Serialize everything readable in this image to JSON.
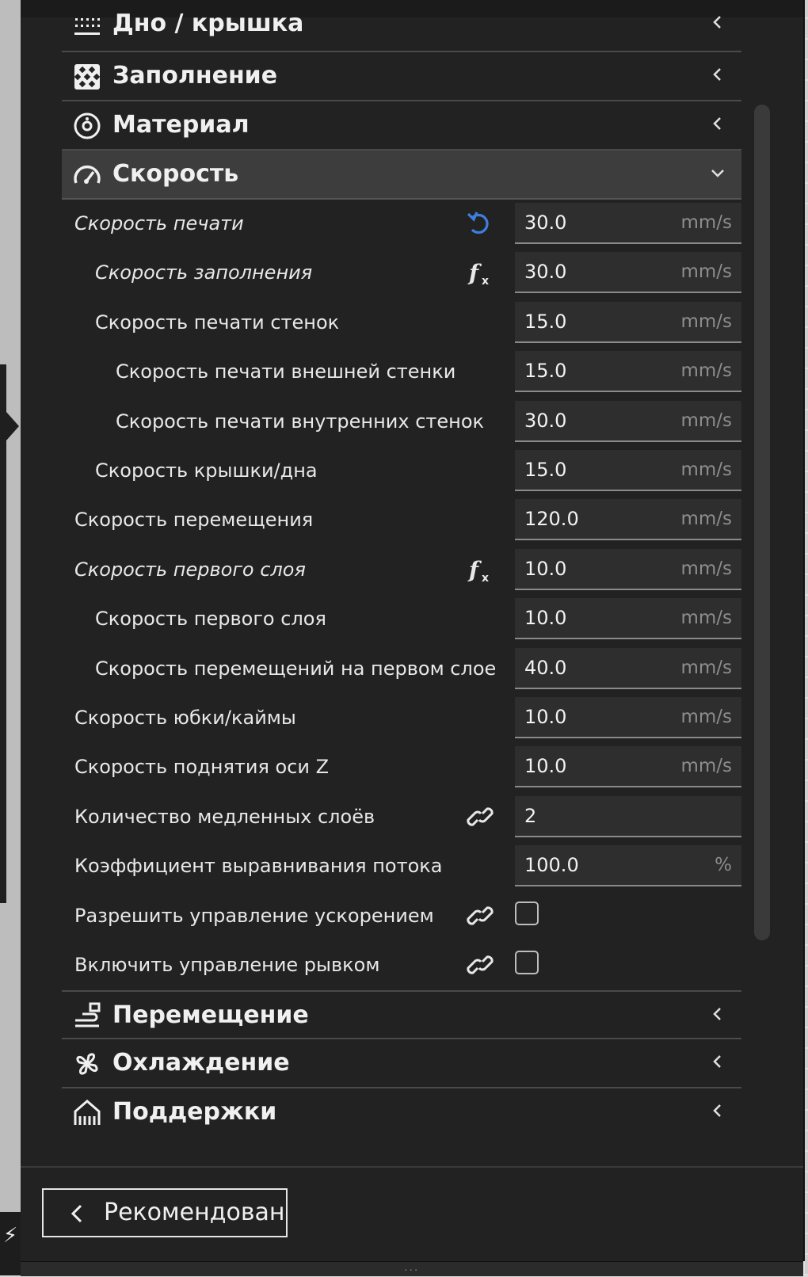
{
  "sections_top": [
    {
      "label": "Дно / крышка",
      "icon": "top-bottom-icon",
      "state": "collapsed"
    },
    {
      "label": "Заполнение",
      "icon": "infill-icon",
      "state": "collapsed"
    },
    {
      "label": "Материал",
      "icon": "material-icon",
      "state": "collapsed"
    },
    {
      "label": "Скорость",
      "icon": "speed-icon",
      "state": "expanded"
    }
  ],
  "speed_settings": [
    {
      "label": "Скорость печати",
      "value": "30.0",
      "unit": "mm/s",
      "italic": true,
      "icon": "reset-icon",
      "indent": 0
    },
    {
      "label": "Скорость заполнения",
      "value": "30.0",
      "unit": "mm/s",
      "italic": true,
      "icon": "function-icon",
      "indent": 1
    },
    {
      "label": "Скорость печати стенок",
      "value": "15.0",
      "unit": "mm/s",
      "italic": false,
      "icon": "",
      "indent": 1
    },
    {
      "label": "Скорость печати внешней стенки",
      "value": "15.0",
      "unit": "mm/s",
      "italic": false,
      "icon": "",
      "indent": 2
    },
    {
      "label": "Скорость печати внутренних стенок",
      "value": "30.0",
      "unit": "mm/s",
      "italic": false,
      "icon": "",
      "indent": 2
    },
    {
      "label": "Скорость крышки/дна",
      "value": "15.0",
      "unit": "mm/s",
      "italic": false,
      "icon": "",
      "indent": 1
    },
    {
      "label": "Скорость перемещения",
      "value": "120.0",
      "unit": "mm/s",
      "italic": false,
      "icon": "",
      "indent": 0
    },
    {
      "label": "Скорость первого слоя",
      "value": "10.0",
      "unit": "mm/s",
      "italic": true,
      "icon": "function-icon",
      "indent": 0
    },
    {
      "label": "Скорость первого слоя",
      "value": "10.0",
      "unit": "mm/s",
      "italic": false,
      "icon": "",
      "indent": 1
    },
    {
      "label": "Скорость перемещений на первом слое",
      "value": "40.0",
      "unit": "mm/s",
      "italic": false,
      "icon": "",
      "indent": 1
    },
    {
      "label": "Скорость юбки/каймы",
      "value": "10.0",
      "unit": "mm/s",
      "italic": false,
      "icon": "",
      "indent": 0
    },
    {
      "label": "Скорость поднятия оси Z",
      "value": "10.0",
      "unit": "mm/s",
      "italic": false,
      "icon": "",
      "indent": 0
    },
    {
      "label": "Количество медленных слоёв",
      "value": "2",
      "unit": "",
      "italic": false,
      "icon": "link-icon",
      "indent": 0
    },
    {
      "label": "Коэффициент выравнивания потока",
      "value": "100.0",
      "unit": "%",
      "italic": false,
      "icon": "",
      "indent": 0
    }
  ],
  "checkbox_settings": [
    {
      "label": "Разрешить управление ускорением",
      "checked": false,
      "icon": "link-icon"
    },
    {
      "label": "Включить управление рывком",
      "checked": false,
      "icon": "link-icon"
    }
  ],
  "sections_bottom": [
    {
      "label": "Перемещение",
      "icon": "travel-icon",
      "state": "collapsed"
    },
    {
      "label": "Охлаждение",
      "icon": "cooling-icon",
      "state": "collapsed"
    },
    {
      "label": "Поддержки",
      "icon": "support-icon",
      "state": "collapsed"
    }
  ],
  "recommended_button": {
    "label": "Рекомендован"
  },
  "colors": {
    "panel": "#222222",
    "header_open": "#3d3d3d",
    "field": "#2e2e2e",
    "reset_icon": "#3d7fe0",
    "text": "#e8e8e8",
    "unit": "#8d8d8d"
  }
}
